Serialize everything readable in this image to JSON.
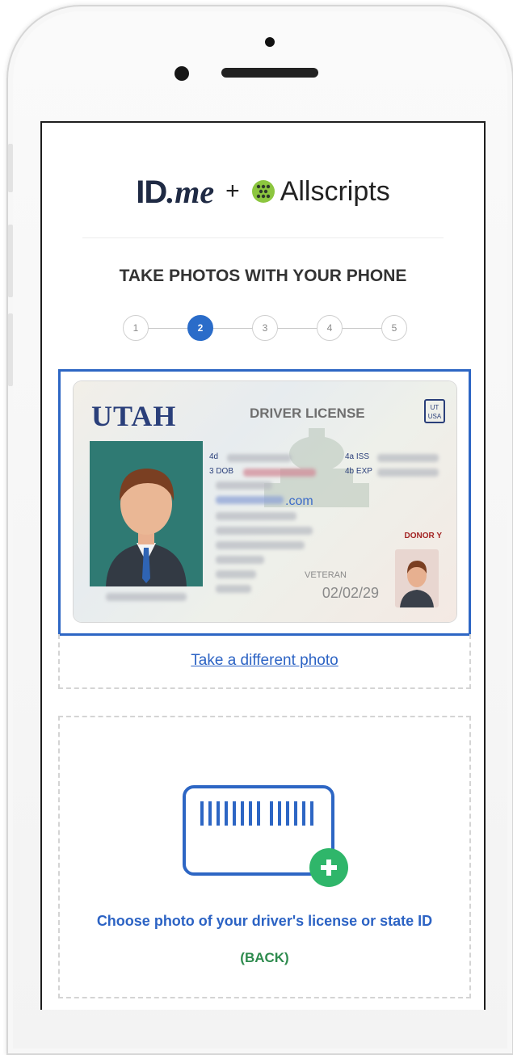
{
  "header": {
    "brand_primary": "ID",
    "brand_primary_suffix": ".me",
    "brand_separator": "+",
    "brand_partner": "Allscripts"
  },
  "page": {
    "title": "TAKE PHOTOS WITH YOUR PHONE"
  },
  "stepper": {
    "steps": [
      "1",
      "2",
      "3",
      "4",
      "5"
    ],
    "active_step": 2
  },
  "license_preview": {
    "state": "UTAH",
    "type": "DRIVER LICENSE",
    "badge_top": "UT",
    "badge_bottom": "USA",
    "field_4d": "4d",
    "field_dob": "3 DOB",
    "field_iss": "4a ISS",
    "field_exp": "4b EXP",
    "donor": "DONOR Y",
    "veteran": "VETERAN",
    "exp_date": "02/02/29",
    "web": ".com"
  },
  "actions": {
    "retake_label": "Take a different photo",
    "upload_prompt": "Choose photo of your driver's license or state ID",
    "upload_side": "(BACK)"
  },
  "colors": {
    "accent_blue": "#2d66c4",
    "success_green": "#2e8b4e",
    "step_active": "#2a6cc9"
  }
}
